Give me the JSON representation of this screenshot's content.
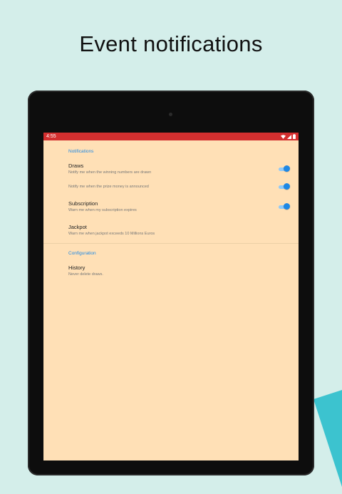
{
  "headline": "Event notifications",
  "status_bar": {
    "time": "4:55"
  },
  "colors": {
    "background": "#d4eeea",
    "status_bar": "#d32f2f",
    "screen_background": "#ffe0b6",
    "accent": "#1e88e5",
    "accent_shape": "#3cc3cf"
  },
  "sections": {
    "notifications": {
      "title": "Notifications",
      "items": [
        {
          "title": "Draws",
          "summary": "Notify me when the winning numbers are drawn",
          "toggle": true,
          "checked": true
        },
        {
          "title": "",
          "summary": "Notify me when the prize money is announced",
          "toggle": true,
          "checked": true
        },
        {
          "title": "Subscription",
          "summary": "Warn me when my subscription expires",
          "toggle": true,
          "checked": true
        },
        {
          "title": "Jackpot",
          "summary": "Warn me when jackpot exceeds 10 Millions Euros",
          "toggle": false
        }
      ]
    },
    "configuration": {
      "title": "Configuration",
      "items": [
        {
          "title": "History",
          "summary": "Never delete draws."
        }
      ]
    }
  },
  "icons": [
    "wifi-icon",
    "signal-icon",
    "battery-icon"
  ]
}
